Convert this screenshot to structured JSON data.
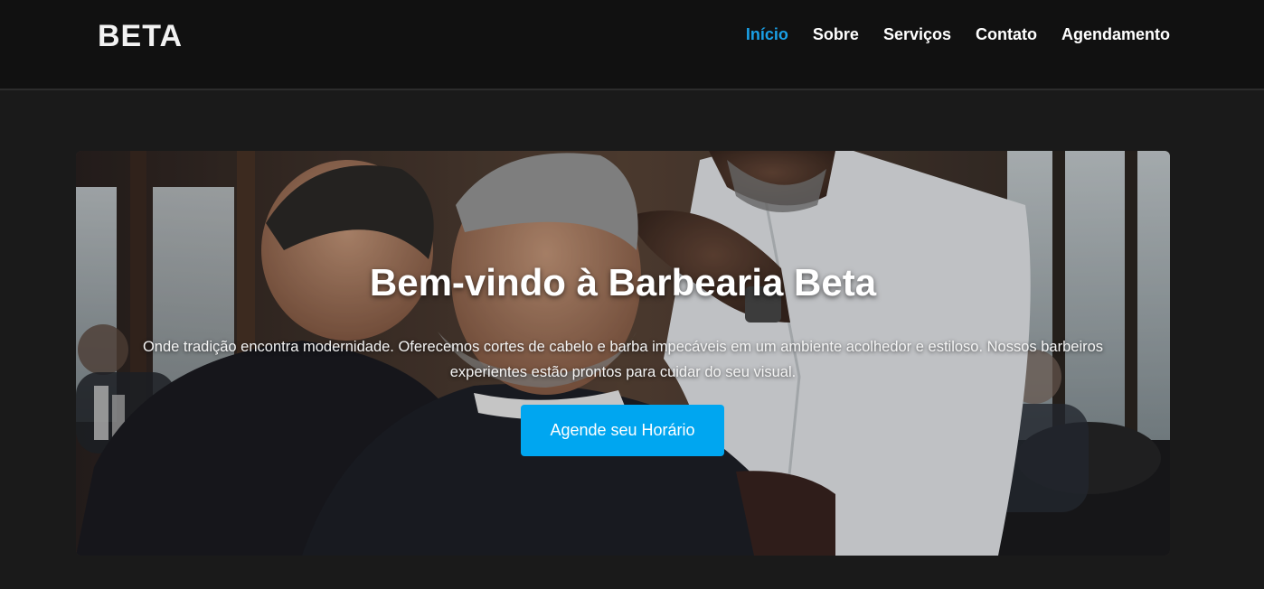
{
  "brand": {
    "logo": "BETA"
  },
  "nav": {
    "items": [
      {
        "label": "Início",
        "active": true
      },
      {
        "label": "Sobre",
        "active": false
      },
      {
        "label": "Serviços",
        "active": false
      },
      {
        "label": "Contato",
        "active": false
      },
      {
        "label": "Agendamento",
        "active": false
      }
    ]
  },
  "hero": {
    "title": "Bem-vindo à Barbearia Beta",
    "text_line1": "Onde tradição encontra modernidade. Oferecemos cortes de cabelo e barba impecáveis em um ambiente acolhedor e estiloso. Nossos barbeiros",
    "text_line2": "experientes estão prontos para cuidar do seu visual.",
    "button_label": "Agende seu Horário",
    "image_subject": "barbershop-photo"
  },
  "colors": {
    "page_background": "#1a1a1a",
    "navbar_background": "#111111",
    "active_link": "#1aa0e6",
    "button_background": "#00a6f0",
    "text": "#ffffff"
  }
}
